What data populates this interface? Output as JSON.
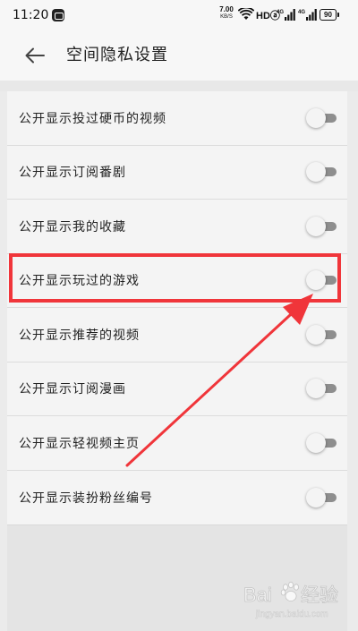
{
  "status_bar": {
    "time": "11:20",
    "net_speed": "7.00",
    "net_speed_unit": "KB/S",
    "hd_label": "HDⓐ",
    "signal1_label": "4G",
    "signal2_label": "4G",
    "battery": "90"
  },
  "header": {
    "back_icon": "arrow-left-icon",
    "title": "空间隐私设置"
  },
  "settings": [
    {
      "label": "公开显示投过硬币的视频",
      "enabled": false
    },
    {
      "label": "公开显示订阅番剧",
      "enabled": false
    },
    {
      "label": "公开显示我的收藏",
      "enabled": false
    },
    {
      "label": "公开显示玩过的游戏",
      "enabled": false
    },
    {
      "label": "公开显示推荐的视频",
      "enabled": false
    },
    {
      "label": "公开显示订阅漫画",
      "enabled": false
    },
    {
      "label": "公开显示轻视频主页",
      "enabled": false
    },
    {
      "label": "公开显示装扮粉丝编号",
      "enabled": false
    }
  ],
  "annotation": {
    "color": "#f0353a",
    "highlighted_item_index": 3
  },
  "watermark": {
    "text": "Baidu经验",
    "sub_text": "jingyan.baidu.com"
  }
}
